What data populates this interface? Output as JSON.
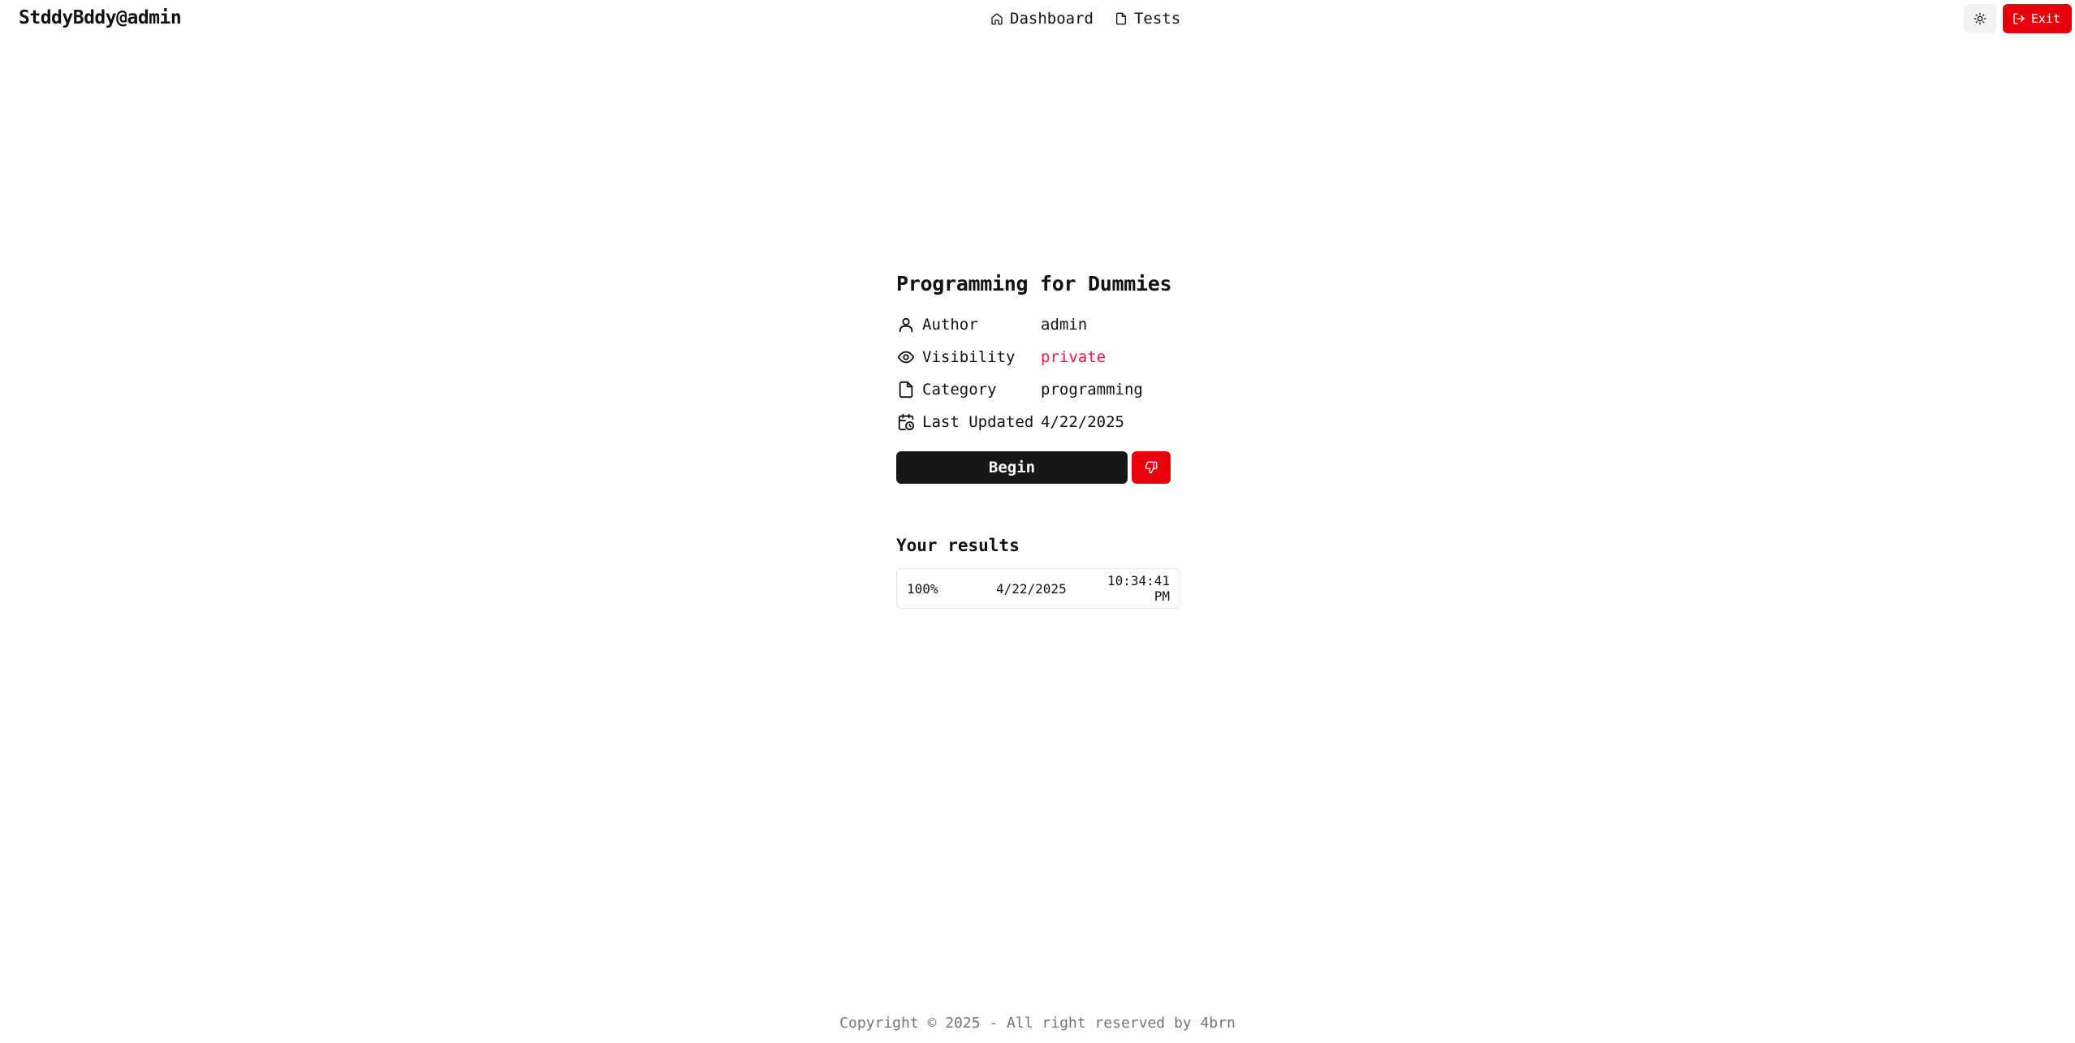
{
  "header": {
    "brand": "StddyBddy@admin",
    "nav": [
      {
        "label": "Dashboard",
        "icon": "home-icon"
      },
      {
        "label": "Tests",
        "icon": "file-icon"
      }
    ],
    "theme_toggle_icon": "sun-icon",
    "exit_label": "Exit",
    "exit_icon": "log-out-icon"
  },
  "test": {
    "title": "Programming for Dummies",
    "meta": [
      {
        "icon": "user-icon",
        "label": "Author",
        "value": "admin"
      },
      {
        "icon": "eye-icon",
        "label": "Visibility",
        "value": "private"
      },
      {
        "icon": "file-icon",
        "label": "Category",
        "value": "programming"
      },
      {
        "icon": "calendar-clock-icon",
        "label": "Last Updated",
        "value": "4/22/2025"
      }
    ],
    "begin_label": "Begin",
    "dislike_icon": "thumbs-down-icon"
  },
  "results": {
    "title": "Your results",
    "rows": [
      {
        "score": "100%",
        "date": "4/22/2025",
        "time": "10:34:41 PM"
      }
    ]
  },
  "footer": {
    "text": "Copyright © 2025 - All right reserved by 4brn"
  },
  "colors": {
    "accent_red": "#e7000b",
    "private_text": "#e11d48",
    "primary_dark": "#171717"
  }
}
